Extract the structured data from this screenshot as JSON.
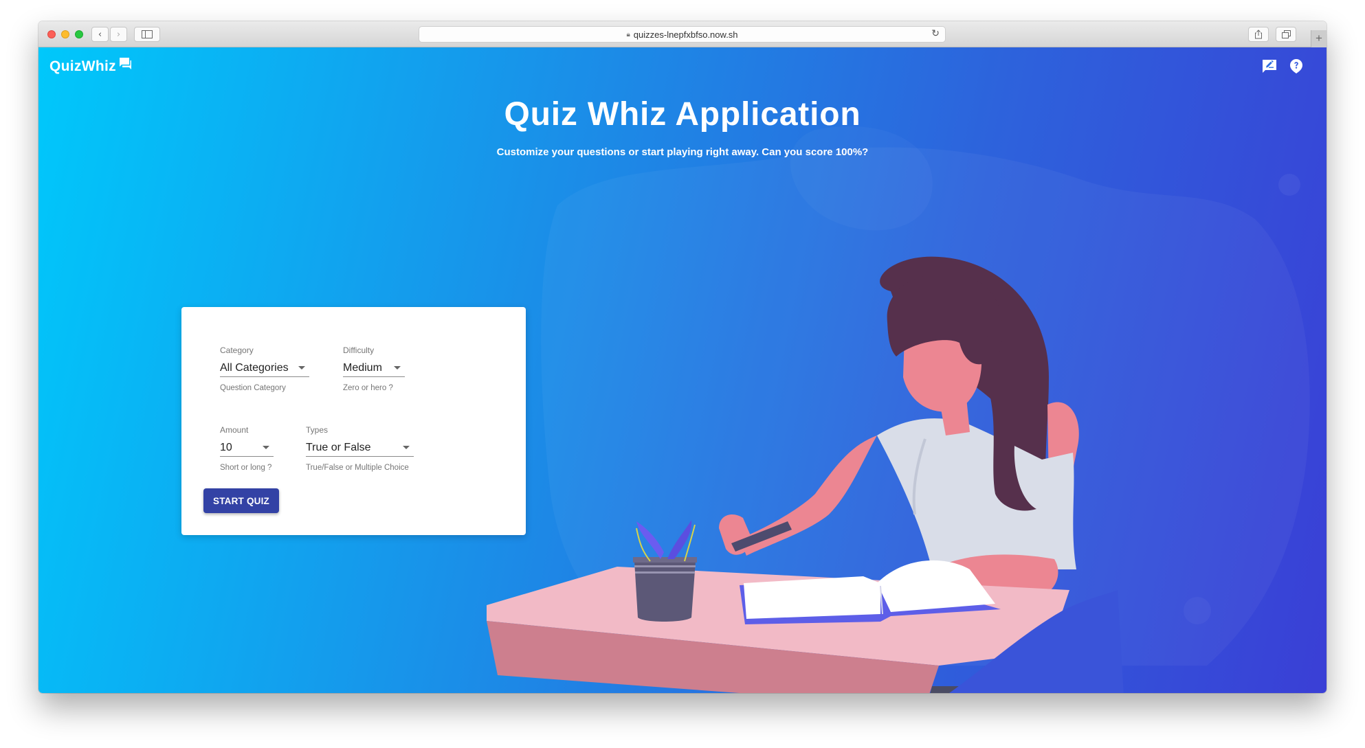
{
  "browser": {
    "url": "quizzes-lnepfxbfso.now.sh",
    "icons": [
      "close-light",
      "minimize-light",
      "zoom-light",
      "back-icon",
      "forward-icon",
      "sidebar-icon",
      "lock-icon",
      "reload-icon",
      "share-icon",
      "tabs-icon",
      "new-tab-icon"
    ]
  },
  "header": {
    "logo_text": "QuizWhiz",
    "logo_icon": "chat-bubbles-icon",
    "actions": [
      {
        "icon": "feedback-icon"
      },
      {
        "icon": "help-icon"
      }
    ]
  },
  "hero": {
    "title": "Quiz Whiz Application",
    "subtitle": "Customize your questions or start playing right away. Can you score 100%?"
  },
  "form": {
    "category": {
      "label": "Category",
      "value": "All Categories",
      "help": "Question Category"
    },
    "difficulty": {
      "label": "Difficulty",
      "value": "Medium",
      "help": "Zero or hero ?"
    },
    "amount": {
      "label": "Amount",
      "value": "10",
      "help": "Short or long ?"
    },
    "types": {
      "label": "Types",
      "value": "True or False",
      "help": "True/False or Multiple Choice"
    },
    "start_label": "START QUIZ"
  },
  "colors": {
    "gradient_start": "#00c8fb",
    "gradient_end": "#3a3fd6",
    "button": "#3342a5",
    "card": "#ffffff"
  }
}
